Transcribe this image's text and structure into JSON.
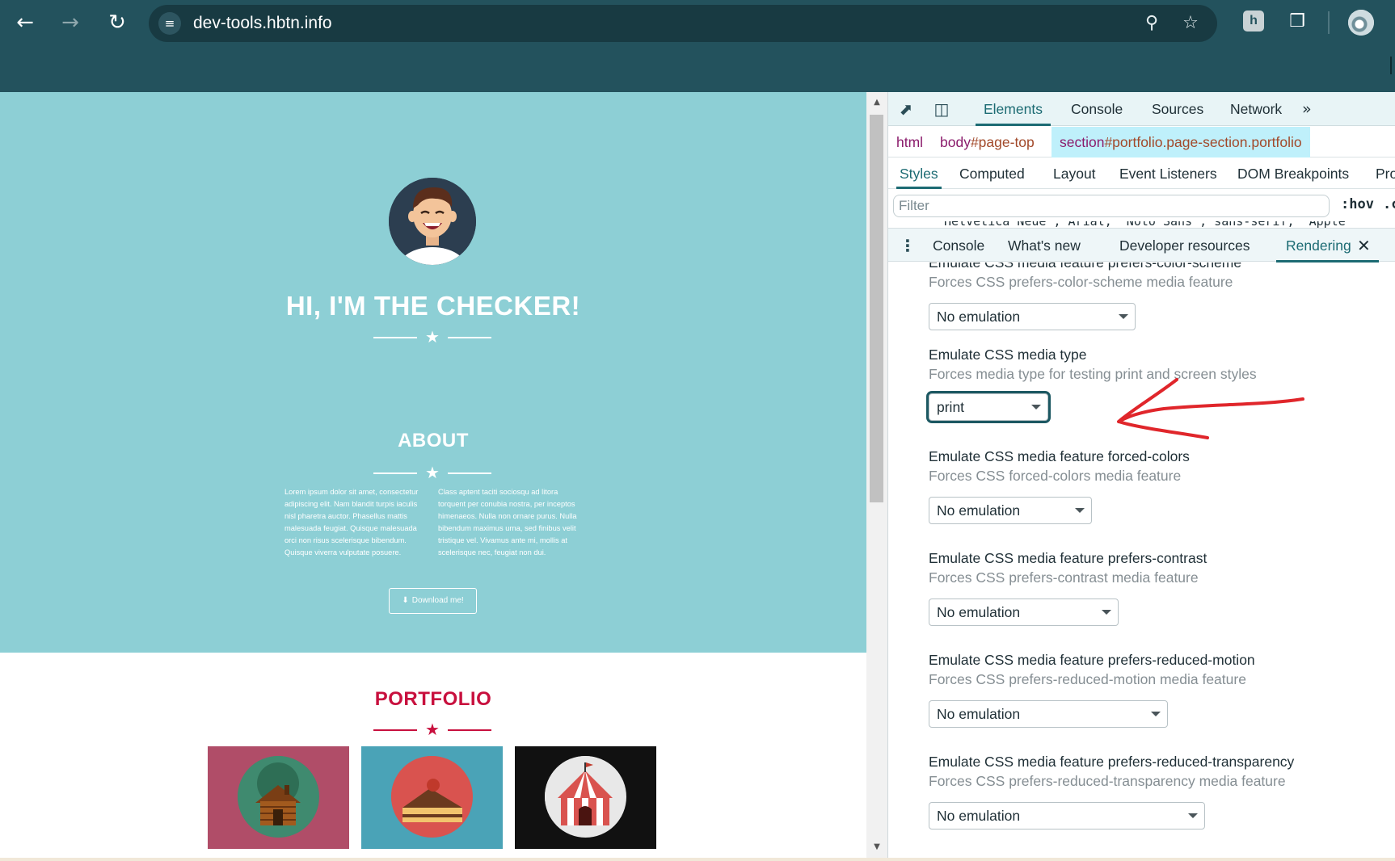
{
  "browser": {
    "url": "dev-tools.hbtn.info",
    "icons": {
      "back": "arrow-left-icon",
      "forward": "arrow-right-icon",
      "reload": "reload-icon",
      "site_info": "tune-icon",
      "zoom": "zoom-out-icon",
      "bookmark": "star-icon",
      "extension": "holberton-extension-icon",
      "extensions": "puzzle-icon",
      "profile": "profile-avatar-icon"
    }
  },
  "page": {
    "hero_title": "HI, I'M THE CHECKER!",
    "about_title": "ABOUT",
    "about_left": "Lorem ipsum dolor sit amet, consectetur adipiscing elit. Nam blandit turpis iaculis nisl pharetra auctor. Phasellus mattis malesuada feugiat. Quisque malesuada orci non risus scelerisque bibendum. Quisque viverra vulputate posuere.",
    "about_right": "Class aptent taciti sociosqu ad litora torquent per conubia nostra, per inceptos himenaeos. Nulla non ornare purus. Nulla bibendum maximus urna, sed finibus velit tristique vel. Vivamus ante mi, mollis at scelerisque nec, feugiat non dui.",
    "download_label": "Download me!",
    "portfolio_title": "PORTFOLIO",
    "portfolio_tiles": [
      "cabin",
      "cake",
      "circus"
    ],
    "colors": {
      "masthead": "#8dcfd5",
      "accent_red": "#c8103e",
      "tile_1": "#b04d68",
      "tile_2": "#4aa3b7",
      "tile_3": "#111111"
    }
  },
  "devtools": {
    "main_tabs": [
      "Elements",
      "Console",
      "Sources",
      "Network"
    ],
    "active_main_tab": "Elements",
    "more_tabs": "»",
    "breadcrumbs": {
      "html": "html",
      "body_tag": "body",
      "body_attr": "#page-top",
      "section_tag": "section",
      "section_attr": "#portfolio.page-section.portfolio"
    },
    "sub_tabs": [
      "Styles",
      "Computed",
      "Layout",
      "Event Listeners",
      "DOM Breakpoints",
      "Pro"
    ],
    "active_sub_tab": "Styles",
    "filter_placeholder": "Filter",
    "hov_label": ":hov",
    "hov_more": ".c",
    "code_peek": "\"Helvetica Neue\", Arial, \"Noto Sans\", sans-serif, \"Apple",
    "drawer_tabs": [
      "Console",
      "What's new",
      "Developer resources",
      "Rendering"
    ],
    "active_drawer_tab": "Rendering",
    "rendering": [
      {
        "title": "Emulate CSS media feature prefers-color-scheme",
        "desc": "Forces CSS prefers-color-scheme media feature",
        "value": "No emulation"
      },
      {
        "title": "Emulate CSS media type",
        "desc": "Forces media type for testing print and screen styles",
        "value": "print"
      },
      {
        "title": "Emulate CSS media feature forced-colors",
        "desc": "Forces CSS forced-colors media feature",
        "value": "No emulation"
      },
      {
        "title": "Emulate CSS media feature prefers-contrast",
        "desc": "Forces CSS prefers-contrast media feature",
        "value": "No emulation"
      },
      {
        "title": "Emulate CSS media feature prefers-reduced-motion",
        "desc": "Forces CSS prefers-reduced-motion media feature",
        "value": "No emulation"
      },
      {
        "title": "Emulate CSS media feature prefers-reduced-transparency",
        "desc": "Forces CSS prefers-reduced-transparency media feature",
        "value": "No emulation"
      }
    ],
    "annotation_color": "#e0262b"
  }
}
